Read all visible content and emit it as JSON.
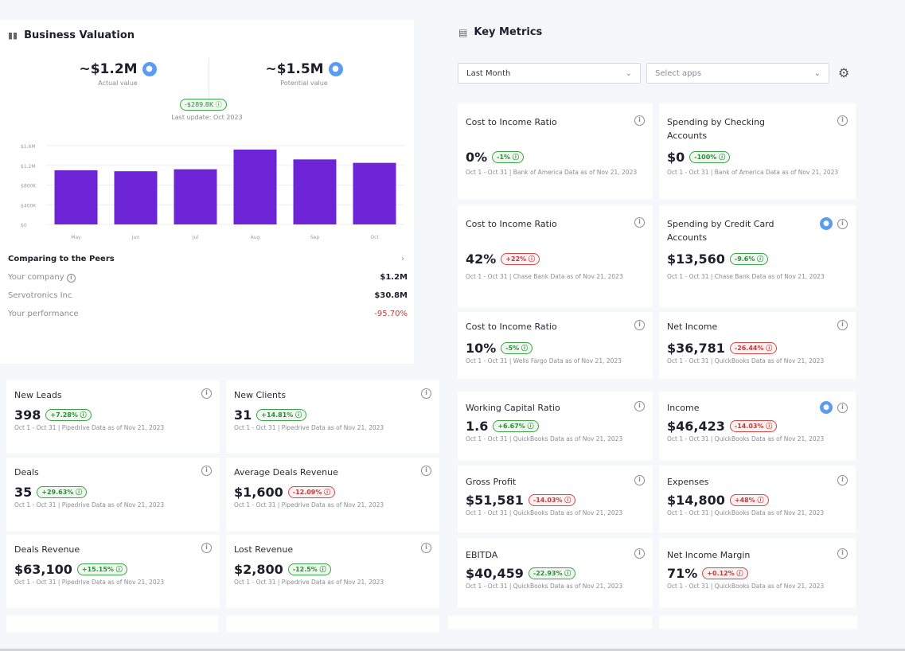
{
  "business_valuation": {
    "title": "Business Valuation",
    "actual": {
      "value": "~$1.2M",
      "label": "Actual value"
    },
    "potential": {
      "value": "~$1.5M",
      "label": "Potential value"
    },
    "difference": "-$289.8K",
    "last_update": "Last update: Oct 2023"
  },
  "chart_data": {
    "type": "bar",
    "categories": [
      "May",
      "Jun",
      "Jul",
      "Aug",
      "Sep",
      "Oct"
    ],
    "values": [
      1.1,
      1.08,
      1.12,
      1.52,
      1.32,
      1.25
    ],
    "ytick_labels": [
      "$0",
      "$400K",
      "$800K",
      "$1.2M",
      "$1.6M"
    ],
    "yticks": [
      0,
      0.4,
      0.8,
      1.2,
      1.6
    ],
    "ylim": [
      0,
      1.6
    ],
    "color": "#6c24d6",
    "grid": true
  },
  "peers": {
    "title": "Comparing to the Peers",
    "rows": [
      {
        "label": "Your company",
        "value": "$1.2M"
      },
      {
        "label": "Servotronics Inc",
        "value": "$30.8M"
      },
      {
        "label": "Your performance",
        "value": "-95.70%"
      }
    ]
  },
  "key_metrics": {
    "title": "Key Metrics",
    "period_select": "Last Month",
    "apps_select_placeholder": "Select apps"
  },
  "metric_cards": [
    {
      "label": "Cost to Income Ratio",
      "value": "0%",
      "badge": "-1%",
      "trend": "up",
      "foot": "Oct 1 - Oct 31 | Bank of America Data as of Nov 21, 2023"
    },
    {
      "label": "Spending by Checking Accounts",
      "value": "$0",
      "badge": "-100%",
      "trend": "up",
      "foot": "Oct 1 - Oct 31 | Bank of America Data as of Nov 21, 2023"
    },
    {
      "label": "Cost to Income Ratio",
      "value": "42%",
      "badge": "+22%",
      "trend": "down",
      "foot": "Oct 1 - Oct 31 | Chase Bank Data as of Nov 21, 2023"
    },
    {
      "label": "Spending by Credit Card Accounts",
      "value": "$13,560",
      "badge": "-9.6%",
      "trend": "up",
      "foot": "Oct 1 - Oct 31 | Chase Bank Data as of Nov 21, 2023"
    },
    {
      "label": "Cost to Income Ratio",
      "value": "10%",
      "badge": "-5%",
      "trend": "up",
      "foot": "Oct 1 - Oct 31 | Wells Fargo Data as of Nov 21, 2023"
    },
    {
      "label": "Net Income",
      "value": "$36,781",
      "badge": "-26.44%",
      "trend": "down",
      "foot": "Oct 1 - Oct 31 | QuickBooks Data as of Nov 21, 2023"
    },
    {
      "label": "Working Capital Ratio",
      "value": "1.6",
      "badge": "+6.67%",
      "trend": "up",
      "foot": "Oct 1 - Oct 31 | QuickBooks Data as of Nov 21, 2023"
    },
    {
      "label": "Income",
      "value": "$46,423",
      "badge": "-14.03%",
      "trend": "down",
      "foot": "Oct 1 - Oct 31 | QuickBooks Data as of Nov 21, 2023"
    },
    {
      "label": "Gross Profit",
      "value": "$51,581",
      "badge": "-14.03%",
      "trend": "down",
      "foot": "Oct 1 - Oct 31 | QuickBooks Data as of Nov 21, 2023"
    },
    {
      "label": "Expenses",
      "value": "$14,800",
      "badge": "+48%",
      "trend": "down",
      "foot": "Oct 1 - Oct 31 | QuickBooks Data as of Nov 21, 2023"
    },
    {
      "label": "EBITDA",
      "value": "$40,459",
      "badge": "-22.93%",
      "trend": "up",
      "foot": "Oct 1 - Oct 31 | QuickBooks Data as of Nov 21, 2023"
    },
    {
      "label": "Net Income Margin",
      "value": "71%",
      "badge": "+0.12%",
      "trend": "down",
      "foot": "Oct 1 - Oct 31 | QuickBooks Data as of Nov 21, 2023"
    }
  ],
  "pipedrive_cards": [
    {
      "label": "New Leads",
      "value": "398",
      "badge": "+7.28%",
      "trend": "up",
      "foot": "Oct 1 - Oct 31 | Pipedrive Data as of Nov 21, 2023"
    },
    {
      "label": "New Clients",
      "value": "31",
      "badge": "+14.81%",
      "trend": "up",
      "foot": "Oct 1 - Oct 31 | Pipedrive Data as of Nov 21, 2023"
    },
    {
      "label": "Deals",
      "value": "35",
      "badge": "+29.63%",
      "trend": "up",
      "foot": "Oct 1 - Oct 31 | Pipedrive Data as of Nov 21, 2023"
    },
    {
      "label": "Average Deals Revenue",
      "value": "$1,600",
      "badge": "-12.09%",
      "trend": "down",
      "foot": "Oct 1 - Oct 31 | Pipedrive Data as of Nov 21, 2023"
    },
    {
      "label": "Deals Revenue",
      "value": "$63,100",
      "badge": "+15.15%",
      "trend": "up",
      "foot": "Oct 1 - Oct 31 | Pipedrive Data as of Nov 21, 2023"
    },
    {
      "label": "Lost Revenue",
      "value": "$2,800",
      "badge": "-12.5%",
      "trend": "up",
      "foot": "Oct 1 - Oct 31 | Pipedrive Data as of Nov 21, 2023"
    }
  ]
}
